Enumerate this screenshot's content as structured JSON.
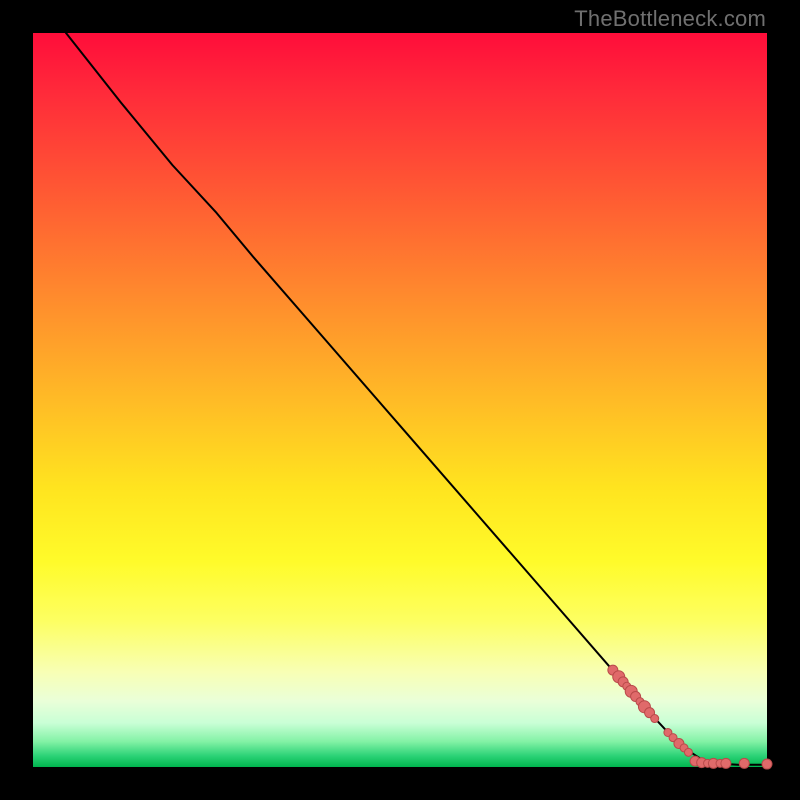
{
  "watermark": "TheBottleneck.com",
  "colors": {
    "dot_fill": "#e06a6a",
    "dot_stroke": "#b94a4a",
    "curve": "#000000",
    "frame": "#000000"
  },
  "chart_data": {
    "type": "line",
    "title": "",
    "xlabel": "",
    "ylabel": "",
    "xlim": [
      0,
      100
    ],
    "ylim": [
      0,
      100
    ],
    "grid": false,
    "legend": false,
    "curve": {
      "name": "bottleneck-curve",
      "points": [
        {
          "x": 4.5,
          "y": 100.0
        },
        {
          "x": 12.0,
          "y": 90.5
        },
        {
          "x": 19.0,
          "y": 82.0
        },
        {
          "x": 25.0,
          "y": 75.5
        },
        {
          "x": 30.0,
          "y": 69.5
        },
        {
          "x": 40.0,
          "y": 58.0
        },
        {
          "x": 50.0,
          "y": 46.5
        },
        {
          "x": 60.0,
          "y": 35.0
        },
        {
          "x": 70.0,
          "y": 23.5
        },
        {
          "x": 80.0,
          "y": 12.0
        },
        {
          "x": 84.0,
          "y": 7.4
        },
        {
          "x": 87.0,
          "y": 4.2
        },
        {
          "x": 89.0,
          "y": 2.4
        },
        {
          "x": 91.0,
          "y": 1.1
        },
        {
          "x": 93.0,
          "y": 0.5
        },
        {
          "x": 96.0,
          "y": 0.3
        },
        {
          "x": 100.0,
          "y": 0.3
        }
      ]
    },
    "series": [
      {
        "name": "highlighted-points",
        "type": "scatter",
        "points": [
          {
            "x": 79.0,
            "y": 13.2,
            "r": 5
          },
          {
            "x": 79.8,
            "y": 12.3,
            "r": 6
          },
          {
            "x": 80.4,
            "y": 11.6,
            "r": 5
          },
          {
            "x": 80.9,
            "y": 11.0,
            "r": 4
          },
          {
            "x": 81.5,
            "y": 10.3,
            "r": 6
          },
          {
            "x": 82.1,
            "y": 9.6,
            "r": 5
          },
          {
            "x": 82.7,
            "y": 8.9,
            "r": 4
          },
          {
            "x": 83.3,
            "y": 8.2,
            "r": 6
          },
          {
            "x": 84.0,
            "y": 7.4,
            "r": 5
          },
          {
            "x": 84.7,
            "y": 6.6,
            "r": 4
          },
          {
            "x": 86.5,
            "y": 4.7,
            "r": 4
          },
          {
            "x": 87.2,
            "y": 4.0,
            "r": 4
          },
          {
            "x": 88.0,
            "y": 3.2,
            "r": 5
          },
          {
            "x": 88.7,
            "y": 2.6,
            "r": 4
          },
          {
            "x": 89.3,
            "y": 2.0,
            "r": 4
          },
          {
            "x": 90.2,
            "y": 0.8,
            "r": 5
          },
          {
            "x": 91.1,
            "y": 0.6,
            "r": 5
          },
          {
            "x": 91.9,
            "y": 0.5,
            "r": 4
          },
          {
            "x": 92.7,
            "y": 0.5,
            "r": 5
          },
          {
            "x": 93.6,
            "y": 0.5,
            "r": 4
          },
          {
            "x": 94.4,
            "y": 0.5,
            "r": 5
          },
          {
            "x": 96.9,
            "y": 0.5,
            "r": 5
          },
          {
            "x": 100.0,
            "y": 0.4,
            "r": 5
          }
        ]
      }
    ]
  }
}
